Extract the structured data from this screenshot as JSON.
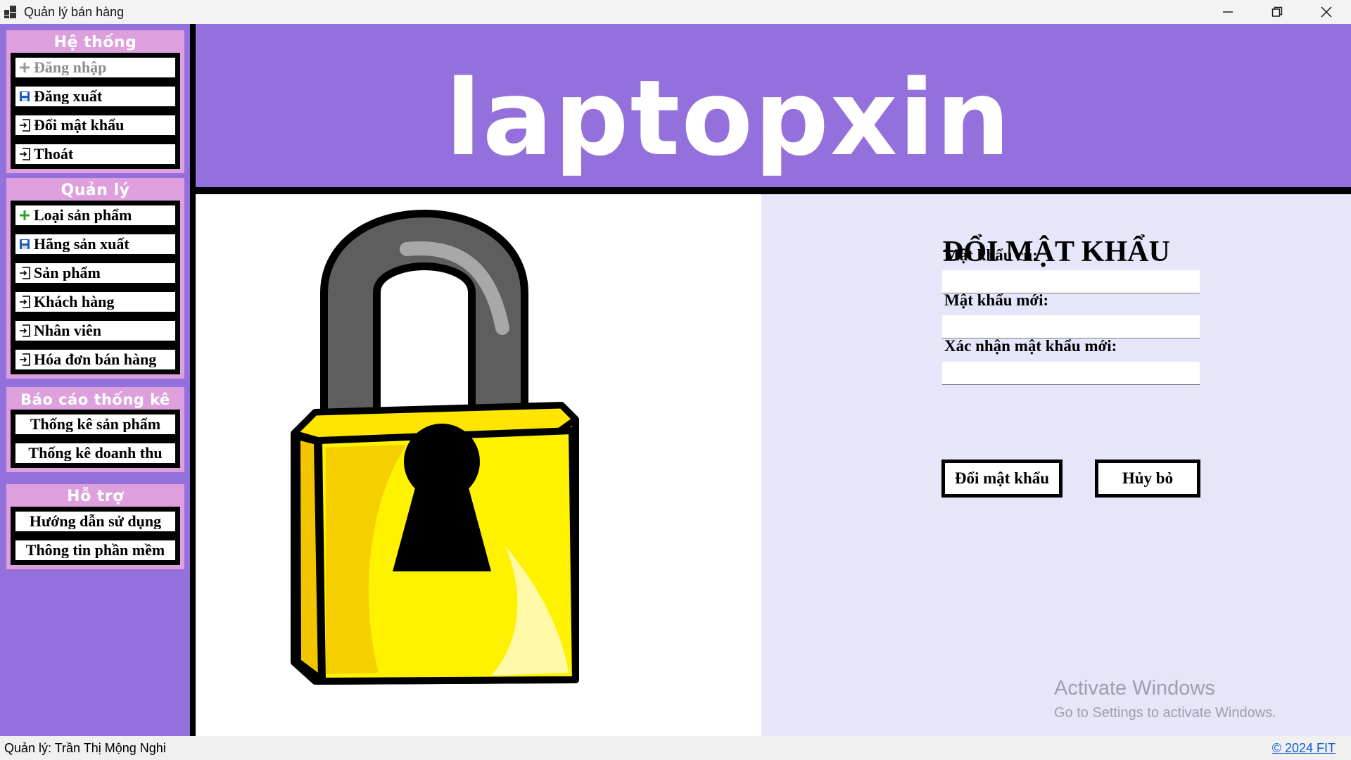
{
  "window": {
    "title": "Quản lý bán hàng",
    "minimize_icon": "minimize-icon",
    "maximize_icon": "restore-icon",
    "close_icon": "close-icon"
  },
  "sidebar": {
    "groups": [
      {
        "title": "Hệ thống",
        "items": [
          {
            "label": "Đăng nhập",
            "icon": "plus-icon",
            "enabled": false
          },
          {
            "label": "Đăng xuất",
            "icon": "save-icon",
            "enabled": true
          },
          {
            "label": "Đổi mật khẩu",
            "icon": "exit-icon",
            "enabled": true
          },
          {
            "label": "Thoát",
            "icon": "exit-icon",
            "enabled": true
          }
        ]
      },
      {
        "title": "Quản lý",
        "items": [
          {
            "label": "Loại sản phẩm",
            "icon": "plus-icon"
          },
          {
            "label": "Hãng sản xuất",
            "icon": "save-icon"
          },
          {
            "label": "Sản phẩm",
            "icon": "exit-icon"
          },
          {
            "label": "Khách hàng",
            "icon": "exit-icon"
          },
          {
            "label": "Nhân viên",
            "icon": "exit-icon"
          },
          {
            "label": "Hóa đơn bán hàng",
            "icon": "exit-icon"
          }
        ]
      },
      {
        "title": "Báo cáo thống kê",
        "items": [
          {
            "label": "Thống kê sản phẩm"
          },
          {
            "label": "Thống kê doanh thu"
          }
        ]
      },
      {
        "title": "Hỗ trợ",
        "items": [
          {
            "label": "Hướng dẫn sử dụng"
          },
          {
            "label": "Thông tin phần mềm"
          }
        ]
      }
    ]
  },
  "banner": {
    "logo_text": "laptopxin",
    "bg_color": "#9370db"
  },
  "form": {
    "title": "ĐỔI MẬT KHẨU",
    "old_password_label": "Mật khẩu cũ:",
    "old_password_value": "",
    "new_password_label": "Mật khẩu mới:",
    "new_password_value": "",
    "confirm_password_label": "Xác nhận mật khẩu mới:",
    "confirm_password_value": "",
    "submit_label": "Đổi mật khẩu",
    "cancel_label": "Hủy bỏ"
  },
  "watermark": {
    "line1": "Activate Windows",
    "line2": "Go to Settings to activate Windows."
  },
  "statusbar": {
    "user_text": "Quản lý: Trần Thị Mộng Nghi",
    "copyright_link": "© 2024 FIT"
  },
  "image": {
    "icon": "padlock-icon"
  }
}
